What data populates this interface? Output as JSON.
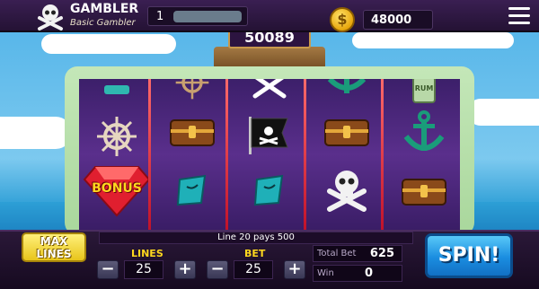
{
  "player": {
    "name": "GAMBLER",
    "rank": "Basic Gambler",
    "level": "1"
  },
  "coins": {
    "value": "48000"
  },
  "jackpot": {
    "value": "50089"
  },
  "reels": {
    "columns": [
      [
        "partial-symbol",
        "ships-wheel",
        "bonus-gem"
      ],
      [
        "ships-wheel",
        "treasure-chest",
        "treasure-map"
      ],
      [
        "crossbones",
        "pirate-flag",
        "treasure-map"
      ],
      [
        "anchor",
        "treasure-chest",
        "skull-crossbones"
      ],
      [
        "rum-bottle",
        "anchor",
        "treasure-chest"
      ]
    ],
    "bonus_text": "BONUS",
    "rum_text": "RUM"
  },
  "controls": {
    "max_lines_label": [
      "MAX",
      "LINES"
    ],
    "message": "Line 20 pays 500",
    "lines_label": "LINES",
    "lines_value": "25",
    "bet_label": "BET",
    "bet_value": "25",
    "minus": "−",
    "plus": "+",
    "total_bet_label": "Total Bet",
    "total_bet_value": "625",
    "win_label": "Win",
    "win_value": "0",
    "spin_label": "SPIN!"
  },
  "colors": {
    "accent": "#ffd81e",
    "spin": "#1a8de0",
    "reel_bg": "#4a2678",
    "divider": "#d41a30"
  }
}
